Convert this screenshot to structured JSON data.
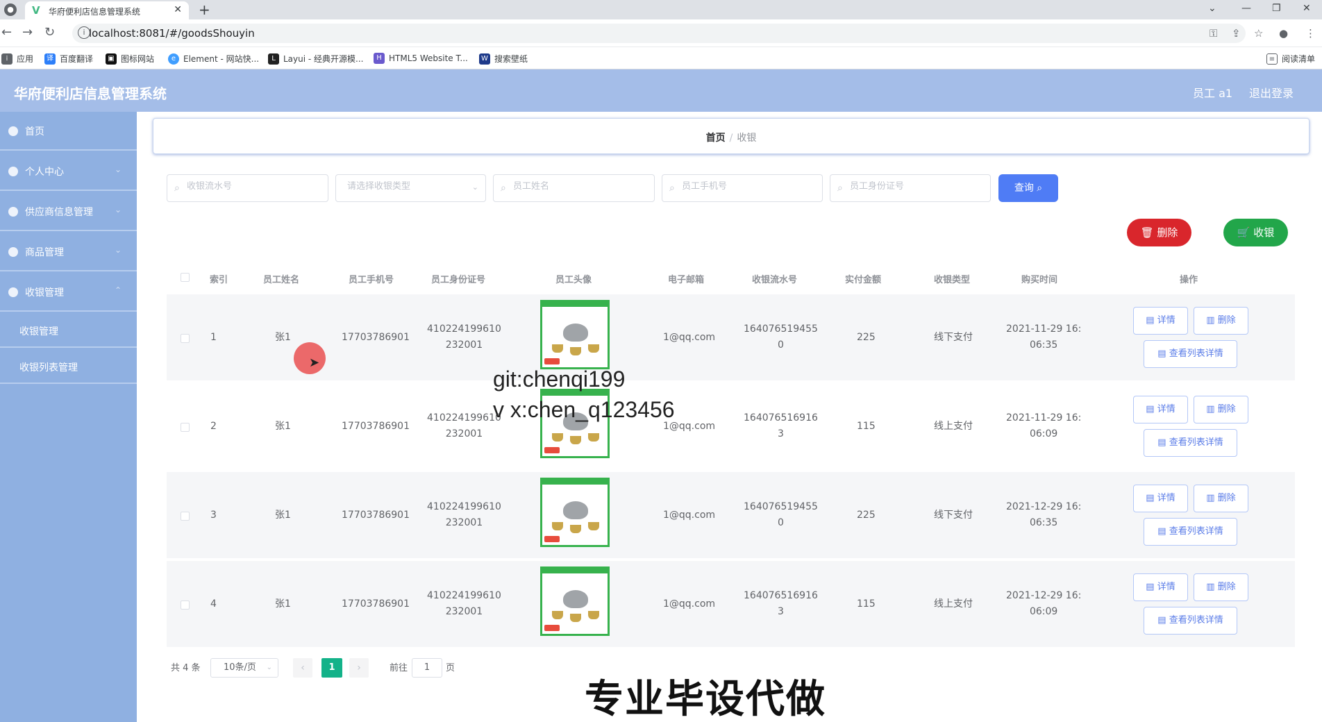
{
  "browser": {
    "tab_title": "华府便利店信息管理系统",
    "url": "localhost:8081/#/goodsShouyin",
    "bookmarks": [
      "应用",
      "百度翻译",
      "图标网站",
      "Element - 网站快...",
      "Layui - 经典开源模...",
      "HTML5 Website T...",
      "搜索壁纸"
    ],
    "reading_list": "阅读清单"
  },
  "header": {
    "title": "华府便利店信息管理系统",
    "user": "员工 a1",
    "logout": "退出登录"
  },
  "sidebar": {
    "items": [
      {
        "label": "首页",
        "icon": "home-icon"
      },
      {
        "label": "个人中心",
        "icon": "user-icon"
      },
      {
        "label": "供应商信息管理",
        "icon": "supplier-icon"
      },
      {
        "label": "商品管理",
        "icon": "goods-icon"
      },
      {
        "label": "收银管理",
        "icon": "cashier-icon"
      }
    ],
    "sub_items": [
      "收银管理",
      "收银列表管理"
    ]
  },
  "breadcrumb": {
    "home": "首页",
    "current": "收银"
  },
  "search": {
    "serial_placeholder": "收银流水号",
    "type_placeholder": "请选择收银类型",
    "name_placeholder": "员工姓名",
    "phone_placeholder": "员工手机号",
    "idcard_placeholder": "员工身份证号",
    "query_label": "查询"
  },
  "actions": {
    "delete_label": "删除",
    "cashier_label": "收银"
  },
  "table": {
    "columns": [
      "索引",
      "员工姓名",
      "员工手机号",
      "员工身份证号",
      "员工头像",
      "电子邮箱",
      "收银流水号",
      "实付金额",
      "收银类型",
      "购买时间",
      "操作"
    ],
    "rows": [
      {
        "index": "1",
        "name": "张1",
        "phone": "17703786901",
        "idcard_1": "410224199610",
        "idcard_2": "232001",
        "email": "1@qq.com",
        "serial_1": "164076519455",
        "serial_2": "0",
        "amount": "225",
        "type": "线下支付",
        "time_1": "2021-11-29 16:",
        "time_2": "06:35"
      },
      {
        "index": "2",
        "name": "张1",
        "phone": "17703786901",
        "idcard_1": "410224199610",
        "idcard_2": "232001",
        "email": "1@qq.com",
        "serial_1": "164076516916",
        "serial_2": "3",
        "amount": "115",
        "type": "线上支付",
        "time_1": "2021-11-29 16:",
        "time_2": "06:09"
      },
      {
        "index": "3",
        "name": "张1",
        "phone": "17703786901",
        "idcard_1": "410224199610",
        "idcard_2": "232001",
        "email": "1@qq.com",
        "serial_1": "164076519455",
        "serial_2": "0",
        "amount": "225",
        "type": "线下支付",
        "time_1": "2021-12-29 16:",
        "time_2": "06:35"
      },
      {
        "index": "4",
        "name": "张1",
        "phone": "17703786901",
        "idcard_1": "410224199610",
        "idcard_2": "232001",
        "email": "1@qq.com",
        "serial_1": "164076516916",
        "serial_2": "3",
        "amount": "115",
        "type": "线上支付",
        "time_1": "2021-12-29 16:",
        "time_2": "06:09"
      }
    ],
    "op_detail": "详情",
    "op_delete": "删除",
    "op_list_detail": "查看列表详情"
  },
  "pagination": {
    "total": "共 4 条",
    "page_size": "10条/页",
    "current": "1",
    "goto_prefix": "前往",
    "goto_value": "1",
    "goto_suffix": "页"
  },
  "overlay": {
    "watermark_1": "git:chenqi199",
    "watermark_2": "v x:chen_q123456",
    "watermark_3": "专业毕设代做"
  },
  "colors": {
    "header_bg": "#a4bde8",
    "sidebar_bg": "#8fb0e1",
    "primary": "#4f7cf5",
    "danger": "#d9262c",
    "success": "#22a64a",
    "pager_active": "#13b289"
  }
}
